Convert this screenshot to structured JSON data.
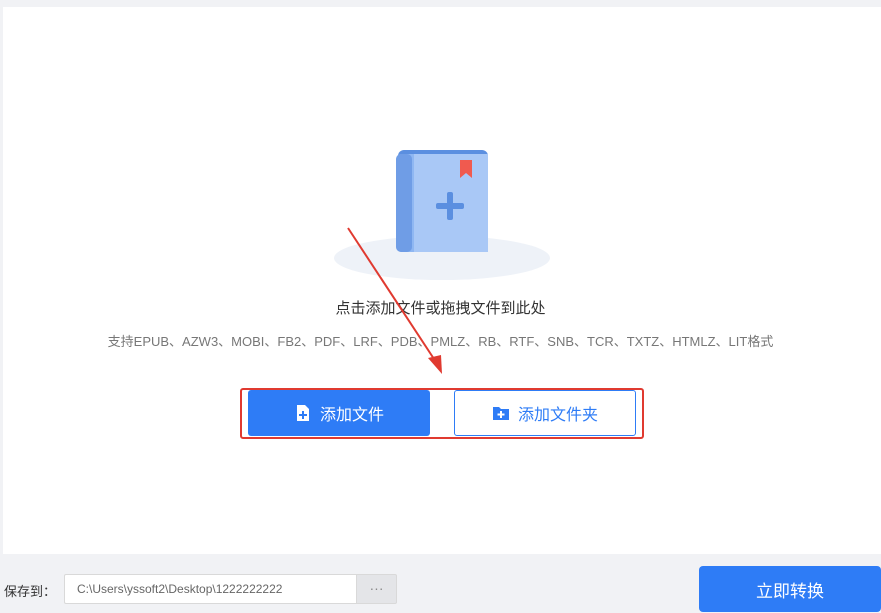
{
  "dropzone": {
    "hint": "点击添加文件或拖拽文件到此处",
    "formats": "支持EPUB、AZW3、MOBI、FB2、PDF、LRF、PDB、PMLZ、RB、RTF、SNB、TCR、TXTZ、HTMLZ、LIT格式"
  },
  "actions": {
    "add_file": "添加文件",
    "add_folder": "添加文件夹"
  },
  "footer": {
    "save_label": "保存到：",
    "save_path": "C:\\Users\\yssoft2\\Desktop\\1222222222",
    "browse": "···",
    "convert": "立即转换"
  },
  "colors": {
    "accent": "#2e7cf6",
    "highlight": "#e03a30"
  },
  "icons": {
    "illustration": "book-plus-icon",
    "add_file": "file-plus-icon",
    "add_folder": "folder-plus-icon"
  }
}
